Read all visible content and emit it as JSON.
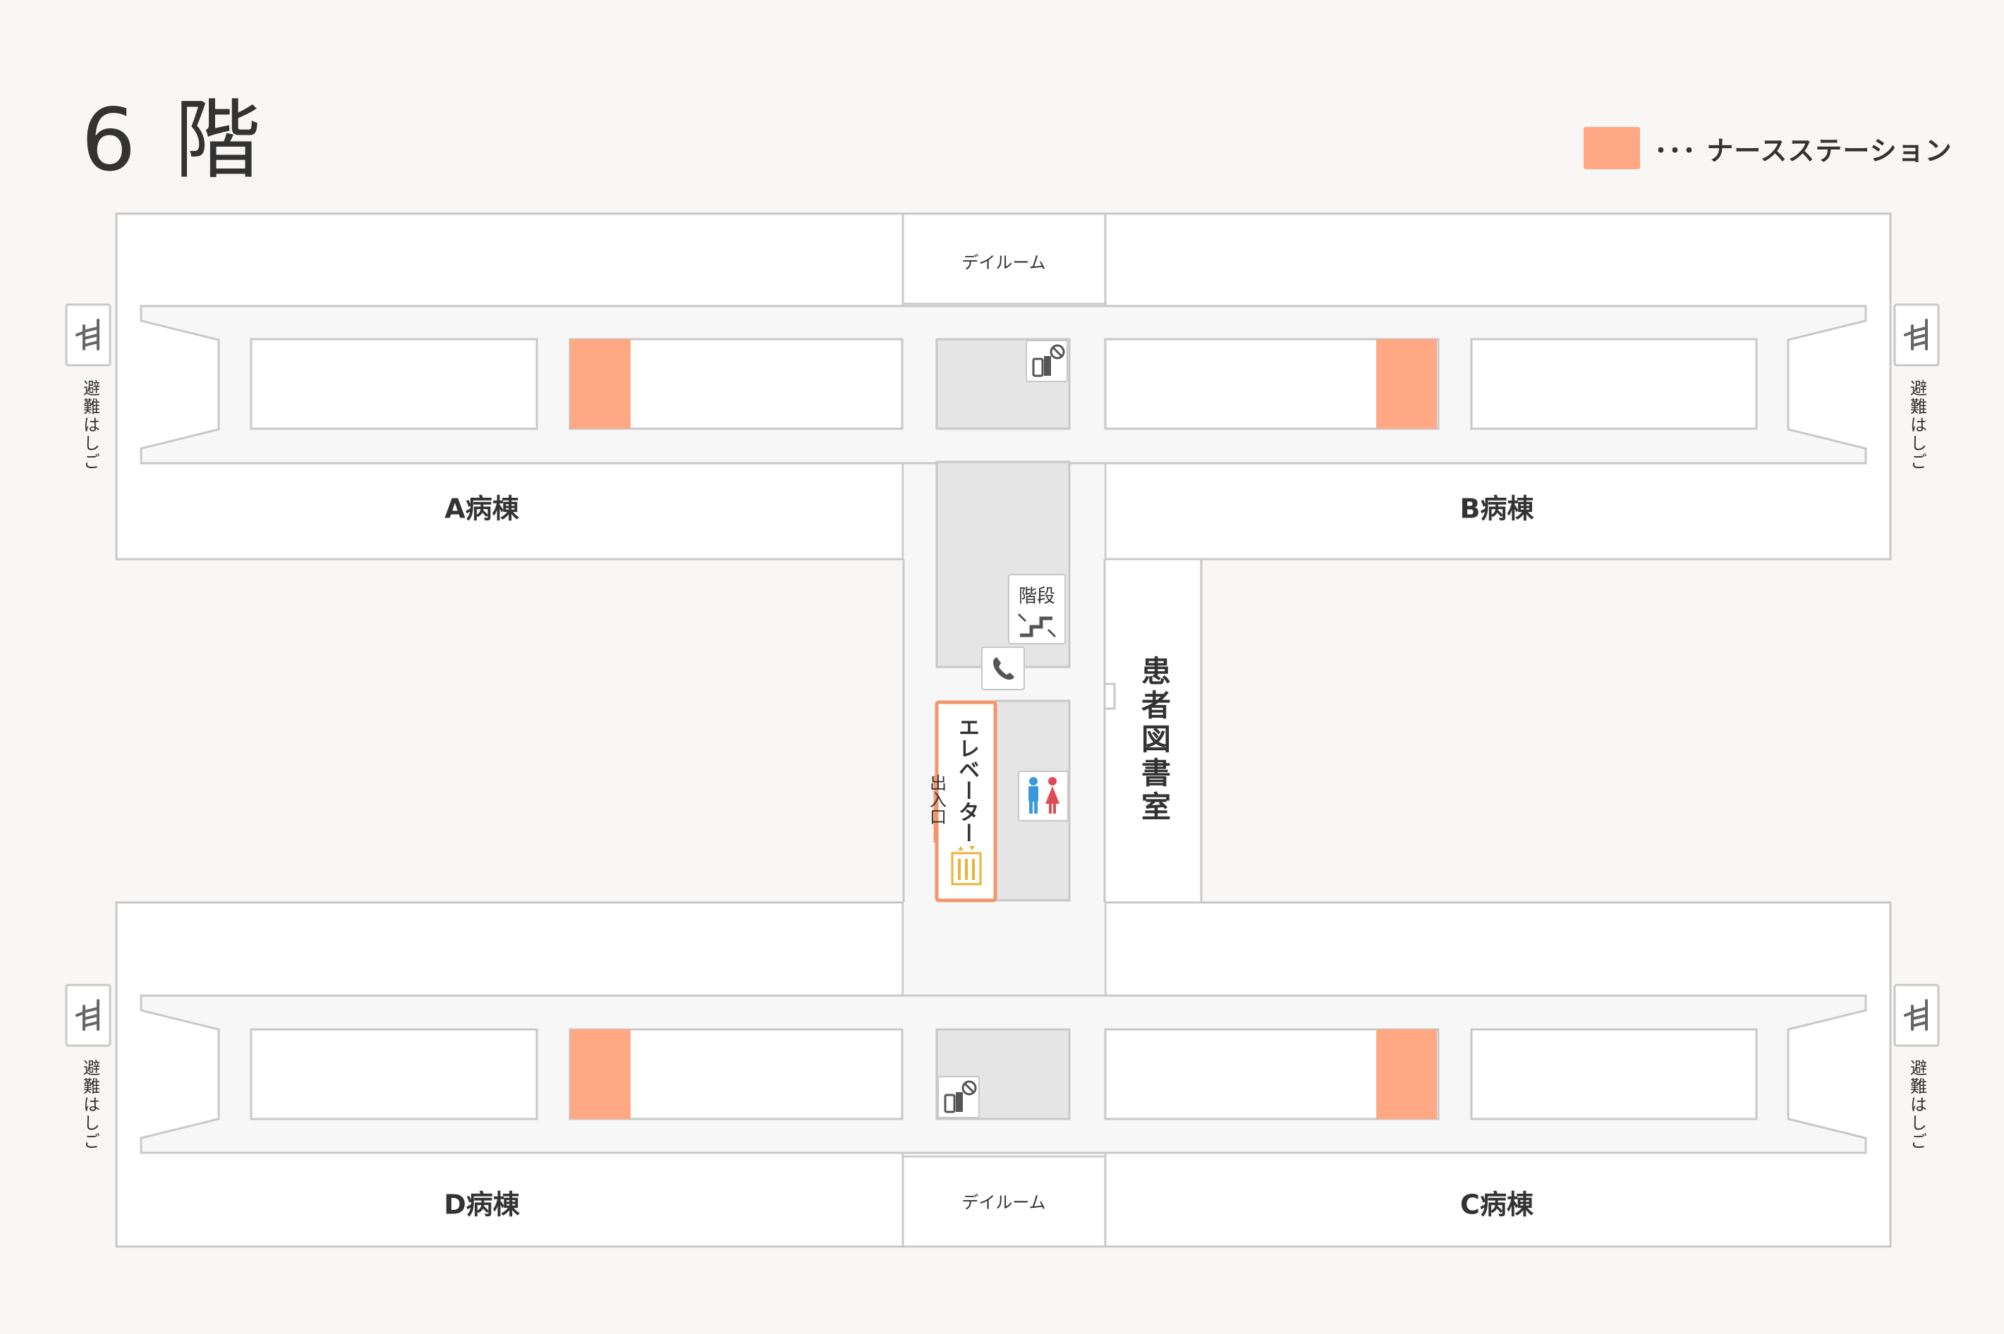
{
  "floor": {
    "title": "6 階"
  },
  "legend": {
    "label": "･･･ ナースステーション",
    "nurse_station_color": "#ffa883"
  },
  "colors": {
    "background": "#f8f7f5",
    "room": "#ffffff",
    "service": "#e5e5e5",
    "wall": "#c8c8c8",
    "elevator_accent": "#f5956b",
    "elevator_icon": "#e8b43a"
  },
  "wards": [
    {
      "id": "a",
      "label": "A病棟"
    },
    {
      "id": "b",
      "label": "B病棟"
    },
    {
      "id": "c",
      "label": "C病棟"
    },
    {
      "id": "d",
      "label": "D病棟"
    }
  ],
  "dayroom": {
    "top_label": "デイルーム",
    "bottom_label": "デイルーム"
  },
  "library": {
    "label": "患者図書室"
  },
  "elevator": {
    "label": "エレベーター",
    "entrance_label": "出入口"
  },
  "stairs": {
    "label": "階段"
  },
  "evacuation_ladder": {
    "label": "避難はしご"
  },
  "icons": [
    "ladder-icon",
    "stairs-icon",
    "phone-icon",
    "restroom-icon",
    "elevator-icon",
    "fire-extinguisher-icon",
    "no-smoking-icon"
  ]
}
